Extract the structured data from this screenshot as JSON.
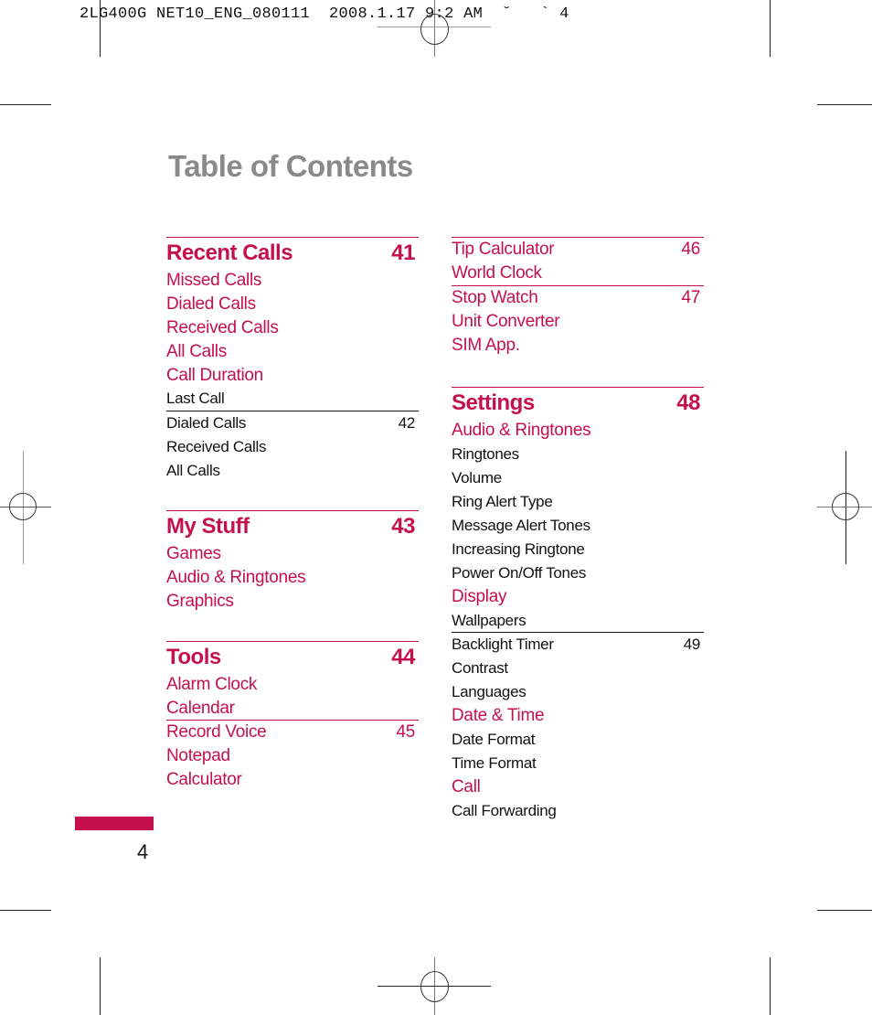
{
  "slug": "2LG400G NET10_ENG_080111  2008.1.17 9:2 AM  ˘   ` 4",
  "title": "Table of Contents",
  "colors": {
    "accent": "#c4104c",
    "title_gray": "#8a8a8a",
    "text": "#111111"
  },
  "page_number": "4",
  "left_column": [
    {
      "level": "h1",
      "label": "Recent Calls",
      "page": "41",
      "rule": "accent"
    },
    {
      "level": "l2",
      "label": "Missed Calls"
    },
    {
      "level": "l2",
      "label": "Dialed Calls"
    },
    {
      "level": "l2",
      "label": "Received Calls"
    },
    {
      "level": "l2",
      "label": "All Calls"
    },
    {
      "level": "l2",
      "label": "Call Duration"
    },
    {
      "level": "l3",
      "label": "Last Call"
    },
    {
      "level": "l3",
      "label": "Dialed Calls",
      "page": "42",
      "rule": "dark"
    },
    {
      "level": "l3",
      "label": "Received Calls"
    },
    {
      "level": "l3",
      "label": "All Calls"
    },
    {
      "level": "gap"
    },
    {
      "level": "h1",
      "label": "My Stuff",
      "page": "43",
      "rule": "accent"
    },
    {
      "level": "l2",
      "label": "Games"
    },
    {
      "level": "l2",
      "label": "Audio & Ringtones"
    },
    {
      "level": "l2",
      "label": "Graphics"
    },
    {
      "level": "gap"
    },
    {
      "level": "h1",
      "label": "Tools",
      "page": "44",
      "rule": "accent"
    },
    {
      "level": "l2",
      "label": "Alarm Clock"
    },
    {
      "level": "l2",
      "label": "Calendar"
    },
    {
      "level": "l2",
      "label": "Record Voice",
      "page": "45",
      "rule": "accent"
    },
    {
      "level": "l2",
      "label": "Notepad"
    },
    {
      "level": "l2",
      "label": "Calculator"
    }
  ],
  "right_column": [
    {
      "level": "l2",
      "label": "Tip Calculator",
      "page": "46",
      "rule": "accent"
    },
    {
      "level": "l2",
      "label": "World Clock"
    },
    {
      "level": "l2",
      "label": "Stop Watch",
      "page": "47",
      "rule": "accent"
    },
    {
      "level": "l2",
      "label": "Unit Converter"
    },
    {
      "level": "l2",
      "label": "SIM App."
    },
    {
      "level": "gapbig"
    },
    {
      "level": "h1",
      "label": "Settings",
      "page": "48",
      "rule": "accent"
    },
    {
      "level": "l2",
      "label": "Audio & Ringtones"
    },
    {
      "level": "l3",
      "label": "Ringtones"
    },
    {
      "level": "l3",
      "label": "Volume"
    },
    {
      "level": "l3",
      "label": "Ring Alert Type"
    },
    {
      "level": "l3",
      "label": "Message Alert Tones"
    },
    {
      "level": "l3",
      "label": "Increasing Ringtone"
    },
    {
      "level": "l3",
      "label": "Power On/Off Tones"
    },
    {
      "level": "l2",
      "label": "Display"
    },
    {
      "level": "l3",
      "label": "Wallpapers"
    },
    {
      "level": "l3",
      "label": "Backlight Timer",
      "page": "49",
      "rule": "dark"
    },
    {
      "level": "l3",
      "label": "Contrast"
    },
    {
      "level": "l3",
      "label": "Languages"
    },
    {
      "level": "l2",
      "label": "Date & Time"
    },
    {
      "level": "l3",
      "label": "Date Format"
    },
    {
      "level": "l3",
      "label": "Time Format"
    },
    {
      "level": "l2",
      "label": "Call"
    },
    {
      "level": "l3",
      "label": "Call Forwarding"
    }
  ]
}
